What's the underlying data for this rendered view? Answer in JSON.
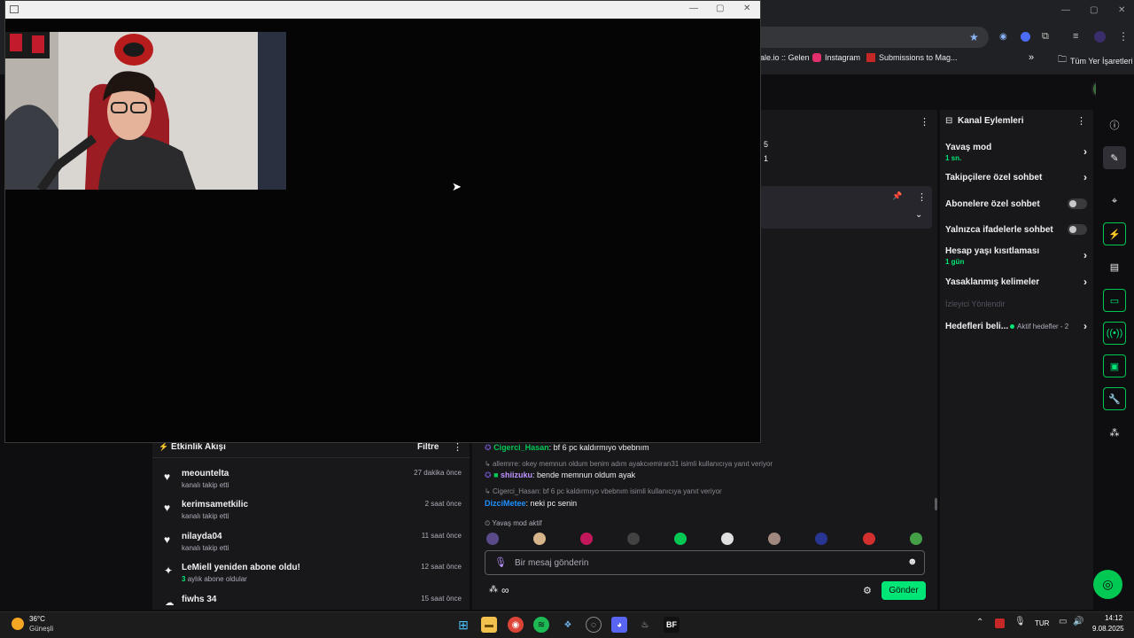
{
  "browser": {
    "bookmarks": [
      {
        "label": "ale.io :: Gelen"
      },
      {
        "label": "Instagram"
      },
      {
        "label": "Submissions to Mag..."
      }
    ],
    "all_bookmarks": "Tüm Yer İşaretleri"
  },
  "activity_panel": {
    "title": "Kanal Eylemleri",
    "items": [
      {
        "label": "Yavaş mod",
        "sub": "1 sn.",
        "control": "chevron"
      },
      {
        "label": "Takipçilere özel sohbet",
        "sub": "",
        "control": "chevron"
      },
      {
        "label": "Abonelere özel sohbet",
        "sub": "",
        "control": "toggle-off"
      },
      {
        "label": "Yalnızca ifadelerle sohbet",
        "sub": "",
        "control": "toggle-off"
      },
      {
        "label": "Hesap yaşı kısıtlaması",
        "sub": "1 gün",
        "control": "chevron"
      },
      {
        "label": "Yasaklanmış kelimeler",
        "sub": "",
        "control": "chevron"
      }
    ],
    "section_label": "İzleyici Yönlendir",
    "goals": {
      "label": "Hedefleri beli...",
      "status": "Aktif hedefler - 2"
    }
  },
  "stats_fragment": {
    "top": "5",
    "bottom": "1"
  },
  "activity_feed": {
    "title": "Etkinlik Akışı",
    "filter": "Filtre",
    "items": [
      {
        "name": "meountelta",
        "sub": "kanalı takip etti",
        "time": "27 dakika önce",
        "icon": "heart-icon"
      },
      {
        "name": "kerimsametkilic",
        "sub": "kanalı takip etti",
        "time": "2 saat önce",
        "icon": "heart-icon"
      },
      {
        "name": "nilayda04",
        "sub": "kanalı takip etti",
        "time": "11 saat önce",
        "icon": "heart-icon"
      },
      {
        "name": "LeMiell yeniden abone oldu!",
        "sub_count": "3",
        "sub": "aylık abone oldular",
        "time": "12 saat önce",
        "icon": "star-icon"
      },
      {
        "name": "fiwhs  34",
        "sub": "",
        "time": "15 saat önce",
        "icon": "cloud-icon"
      }
    ]
  },
  "chat": {
    "messages": [
      {
        "type": "msg",
        "user": "Cigerci_Hasan",
        "user_color": "#00c853",
        "text": "bf 6 pc kaldırmıyo vbebnım"
      },
      {
        "type": "reply",
        "text": "allemrre: okey memnun oldum benim adım ayakcıemiran31 isimli kullanıcıya yanıt veriyor"
      },
      {
        "type": "msg",
        "user": "shiizuku",
        "user_color": "#bf94ff",
        "text": "bende memnun oldum ayak"
      },
      {
        "type": "reply",
        "text": "Cigerci_Hasan: bf 6 pc kaldırmıyo vbebnım isimli kullanıcıya yanıt veriyor"
      },
      {
        "type": "msg",
        "user": "DizciMetee",
        "user_color": "#1e90ff",
        "text": "neki pc senin"
      }
    ],
    "slow_mode": "Yavaş mod aktif",
    "input_placeholder": "Bir mesaj gönderin",
    "send_label": "Gönder"
  },
  "taskbar": {
    "weather_temp": "36°C",
    "weather_desc": "Güneşli",
    "lang": "TUR",
    "time": "14:12",
    "date": "9.08.2025"
  },
  "colors": {
    "accent": "#00e676",
    "send": "#00e676"
  }
}
